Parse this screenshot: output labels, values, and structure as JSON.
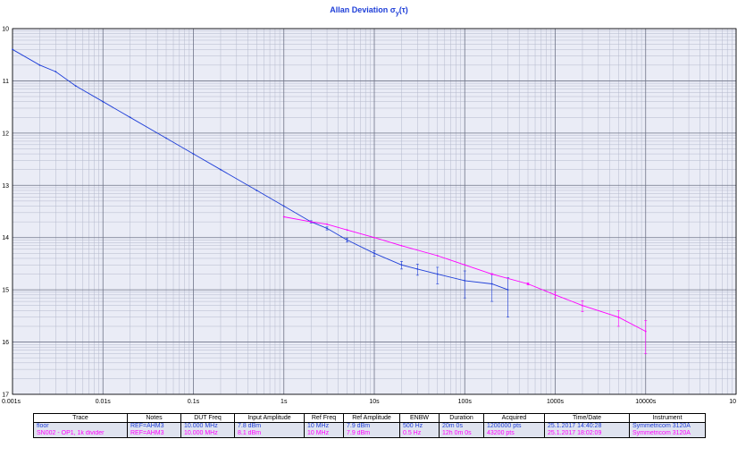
{
  "chart_data": {
    "type": "line",
    "title": "Allan Deviation σy(τ)",
    "title_main": "Allan Deviation σ",
    "title_sub": "y",
    "title_tail": "(τ)",
    "xscale": "log",
    "yscale": "log",
    "xlim": [
      0.001,
      100000
    ],
    "ylim": [
      1e-17,
      1e-10
    ],
    "x_tick_labels": [
      "0.001s",
      "0.01s",
      "0.1s",
      "1s",
      "10s",
      "100s",
      "1000s",
      "10000s",
      "10"
    ],
    "y_tick_labels": [
      "10",
      "11",
      "12",
      "13",
      "14",
      "15",
      "16",
      "17"
    ],
    "grid": true,
    "series": [
      {
        "name": "floor",
        "color": "#1f3fd8",
        "x": [
          0.001,
          0.002,
          0.003,
          0.005,
          0.01,
          0.02,
          0.05,
          0.1,
          0.2,
          0.5,
          1,
          2,
          3,
          5,
          10,
          20,
          30,
          50,
          100,
          200,
          300
        ],
        "y": [
          4e-11,
          2e-11,
          1.5e-11,
          8e-12,
          4e-12,
          2e-12,
          8e-13,
          4e-13,
          2e-13,
          8e-14,
          4e-14,
          2e-14,
          1.5e-14,
          9e-15,
          5e-15,
          3e-15,
          2.5e-15,
          2e-15,
          1.5e-15,
          1.3e-15,
          1e-15
        ],
        "err_lo": [
          0,
          0,
          0,
          0,
          0,
          0,
          0,
          0,
          0,
          0,
          0,
          1e-15,
          1e-15,
          8e-16,
          6e-16,
          5e-16,
          6e-16,
          7e-16,
          8e-16,
          7e-16,
          7e-16
        ],
        "err_hi": [
          0,
          0,
          0,
          0,
          0,
          0,
          0,
          0,
          0,
          0,
          0,
          1e-15,
          1e-15,
          8e-16,
          6e-16,
          5e-16,
          6e-16,
          7e-16,
          8e-16,
          7e-16,
          7e-16
        ]
      },
      {
        "name": "SN002 - OP1, 1k divider",
        "color": "#ff00ff",
        "x": [
          1,
          2,
          3,
          5,
          10,
          20,
          50,
          100,
          200,
          500,
          1000,
          2000,
          5000,
          10000
        ],
        "y": [
          2.5e-14,
          2e-14,
          1.8e-14,
          1.4e-14,
          1e-14,
          7e-15,
          4.5e-15,
          3e-15,
          2e-15,
          1.3e-15,
          8e-16,
          5e-16,
          3e-16,
          1.6e-16
        ],
        "err_lo": [
          0,
          0,
          0,
          0,
          0,
          0,
          0,
          0,
          4e-17,
          6e-17,
          1e-16,
          1.2e-16,
          1e-16,
          1e-16
        ],
        "err_hi": [
          0,
          0,
          0,
          0,
          0,
          0,
          0,
          0,
          4e-17,
          6e-17,
          1e-16,
          1.2e-16,
          1e-16,
          1e-16
        ]
      }
    ]
  },
  "legend_table": {
    "headers": [
      "Trace",
      "Notes",
      "DUT Freq",
      "Input Amplitude",
      "Ref Freq",
      "Ref Amplitude",
      "ENBW",
      "Duration",
      "Acquired",
      "Time/Date",
      "Instrument"
    ],
    "rows": [
      {
        "color": "#1f3fd8",
        "cells": [
          "floor",
          "REF=AHM3",
          "10.000 MHz",
          "7.8 dBm",
          "10 MHz",
          "7.9 dBm",
          "500 Hz",
          "20m 0s",
          "1200000 pts",
          "25.1.2017 14:40:28",
          "Symmetricom 3120A"
        ]
      },
      {
        "color": "#ff00ff",
        "cells": [
          "SN002 - OP1, 1k divider",
          "REF=AHM3",
          "10.000 MHz",
          "8.1 dBm",
          "10 MHz",
          "7.9 dBm",
          "0.5 Hz",
          "12h 0m 0s",
          "43200 pts",
          "25.1.2017 18:02:09",
          "Symmetricom 3120A"
        ]
      }
    ]
  }
}
